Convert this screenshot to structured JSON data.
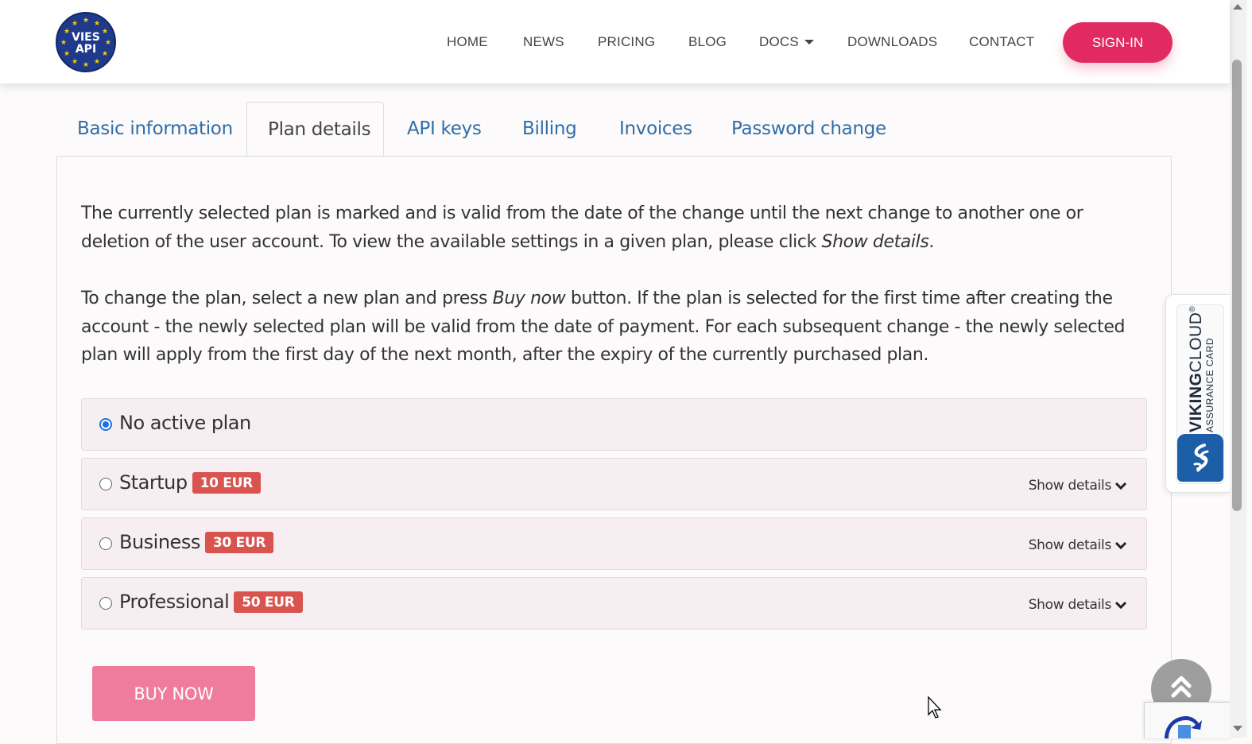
{
  "header": {
    "logo": {
      "line1": "VIES",
      "line2": "API"
    },
    "nav": [
      {
        "label": "HOME"
      },
      {
        "label": "NEWS"
      },
      {
        "label": "PRICING"
      },
      {
        "label": "BLOG"
      },
      {
        "label": "DOCS"
      },
      {
        "label": "DOWNLOADS"
      },
      {
        "label": "CONTACT"
      }
    ],
    "signin_label": "SIGN-IN"
  },
  "tabs": [
    {
      "label": "Basic information",
      "active": false
    },
    {
      "label": "Plan details",
      "active": true
    },
    {
      "label": "API keys",
      "active": false
    },
    {
      "label": "Billing",
      "active": false
    },
    {
      "label": "Invoices",
      "active": false
    },
    {
      "label": "Password change",
      "active": false
    }
  ],
  "content": {
    "para1": {
      "text": "The currently selected plan is marked and is valid from the date of the change until the next change to another one or deletion of the user account. To view the available settings in a given plan, please click ",
      "em": "Show details",
      "end": "."
    },
    "para2": {
      "text_a": "To change the plan, select a new plan and press ",
      "em": "Buy now",
      "text_b": " button. If the plan is selected for the first time after creating the account - the newly selected plan will be valid from the date of payment. For each subsequent change - the newly selected plan will apply from the first day of the next month, after the expiry of the currently purchased plan."
    },
    "plans": [
      {
        "name": "No active plan",
        "price": "",
        "selected": true,
        "details": ""
      },
      {
        "name": "Startup",
        "price": "10 EUR",
        "selected": false,
        "details": "Show details"
      },
      {
        "name": "Business",
        "price": "30 EUR",
        "selected": false,
        "details": "Show details"
      },
      {
        "name": "Professional",
        "price": "50 EUR",
        "selected": false,
        "details": "Show details"
      }
    ],
    "buy_now_label": "BUY NOW"
  },
  "viking_card": {
    "brand_bold": "VIKING",
    "brand_rest": "CLOUD",
    "mark": "®",
    "sub": "ASSURANCE CARD"
  },
  "colors": {
    "accent": "#e22a62",
    "buy_now": "#ef7c9c",
    "badge": "#d9534f",
    "link": "#2f6ea8"
  }
}
